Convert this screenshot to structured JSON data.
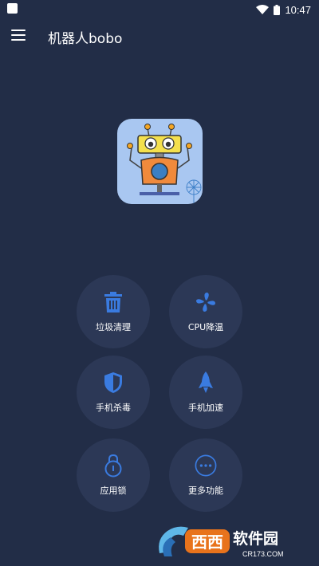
{
  "status_bar": {
    "time": "10:47"
  },
  "app_bar": {
    "title": "机器人bobo"
  },
  "accent_color": "#3a7be0",
  "background_color": "#222d47",
  "features": [
    {
      "label": "垃圾清理",
      "icon": "trash-icon"
    },
    {
      "label": "CPU降温",
      "icon": "fan-icon"
    },
    {
      "label": "手机杀毒",
      "icon": "shield-icon"
    },
    {
      "label": "手机加速",
      "icon": "rocket-icon"
    },
    {
      "label": "应用锁",
      "icon": "lock-icon"
    },
    {
      "label": "更多功能",
      "icon": "more-icon"
    }
  ],
  "watermark": {
    "brand": "西西软件园",
    "url": "CR173.COM"
  }
}
